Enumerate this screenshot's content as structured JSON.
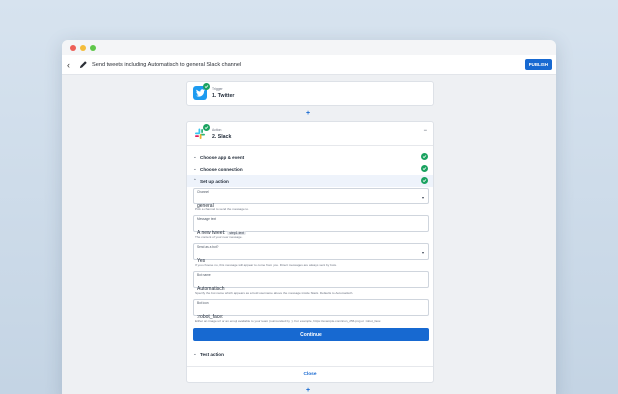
{
  "toolbar": {
    "title": "Send tweets including Automatisch to general Slack channel",
    "publish_label": "PUBLISH",
    "back_icon": "chevron-left-icon",
    "edit_icon": "pencil-icon"
  },
  "trigger": {
    "kind": "Trigger",
    "name": "1. Twitter",
    "icon": "twitter-icon"
  },
  "add_step_label": "+",
  "action": {
    "kind": "Action",
    "name": "2. Slack",
    "icon": "slack-icon",
    "collapse_label": "−",
    "sections": {
      "choose_app": "Choose app & event",
      "choose_connection": "Choose connection",
      "setup": "Set up action",
      "test": "Test action"
    },
    "fields": {
      "channel": {
        "label": "Channel",
        "value": "general",
        "help": "Pick a channel to send the message to."
      },
      "message": {
        "label": "Message text",
        "value_prefix": "A new tweet:",
        "pill": "step1.text",
        "help": "The content of your new message."
      },
      "send_as_bot": {
        "label": "Send as a bot?",
        "value": "Yes",
        "help": "If you choose no, this message will appear to come from you. Direct messages are always sent by bots."
      },
      "bot_name": {
        "label": "Bot name",
        "value": "Automatisch",
        "help": "Specify the bot name which appears as a bold username above the message inside Slack. Defaults to Automatisch."
      },
      "bot_icon": {
        "label": "Bot icon",
        "value": ":robot_face:",
        "help": "Either an image url or an emoji available to your team (surrounded by :). For example, https://example.com/icon_256.png or :robot_face:"
      }
    },
    "continue_label": "Continue",
    "close_label": "Close"
  },
  "colors": {
    "accent": "#1769d1",
    "success": "#1aa260"
  }
}
